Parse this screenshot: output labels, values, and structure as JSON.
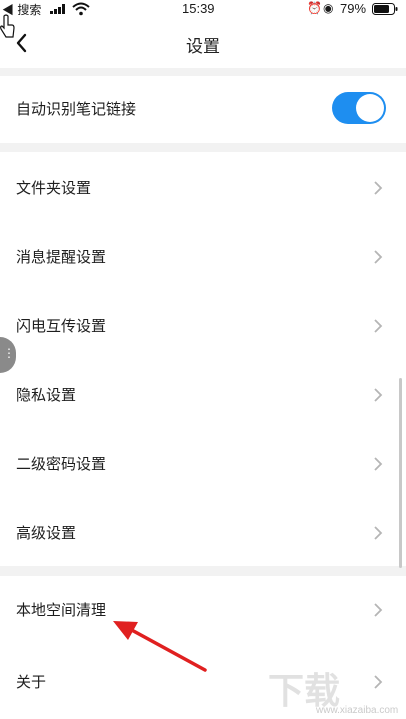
{
  "status_bar": {
    "back_app": "◀ 搜索",
    "time": "15:39",
    "battery": "79%"
  },
  "nav": {
    "title": "设置"
  },
  "toggle_row": {
    "label": "自动识别笔记链接",
    "enabled": true,
    "accent": "#1e8ef0"
  },
  "settings": [
    {
      "label": "文件夹设置"
    },
    {
      "label": "消息提醒设置"
    },
    {
      "label": "闪电互传设置"
    },
    {
      "label": "隐私设置"
    },
    {
      "label": "二级密码设置"
    },
    {
      "label": "高级设置"
    }
  ],
  "bottom": [
    {
      "label": "本地空间清理"
    },
    {
      "label": "关于"
    }
  ],
  "annotation": {
    "color": "#e02020"
  },
  "watermark": {
    "main": "下载",
    "sub": "www.xiazaiba.com"
  }
}
